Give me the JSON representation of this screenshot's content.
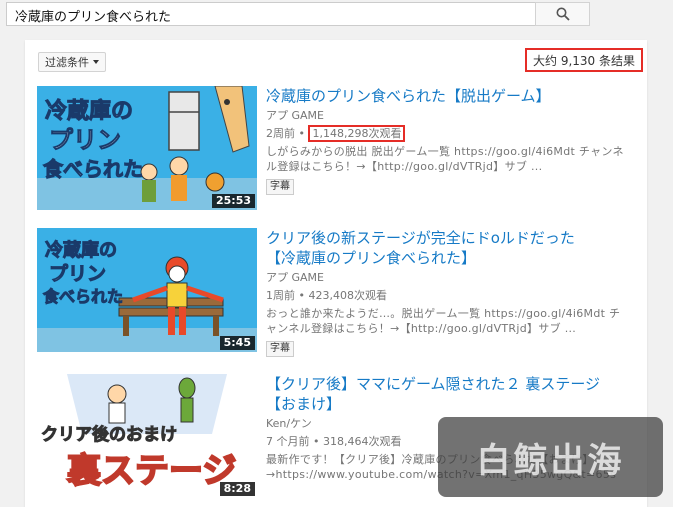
{
  "search": {
    "query": "冷蔵庫のプリン食べられた"
  },
  "toolbar": {
    "filter_label": "过滤条件",
    "result_count": "大约 9,130 条结果"
  },
  "videos": [
    {
      "title": "冷蔵庫のプリン食べられた【脱出ゲーム】",
      "channel": "アプ GAME",
      "age": "2周前 •",
      "views": "1,148,298次观看",
      "desc1": "しがらみからの脱出 脱出ゲーム一覧 https://goo.gl/4i6Mdt チャンネ",
      "desc2": "ル登録はこちら！→【http://goo.gl/dVTRjd】サブ ...",
      "cc": "字幕",
      "duration": "25:53",
      "thumb_text": [
        "冷蔵庫の",
        "プリン",
        "食べられた"
      ]
    },
    {
      "title_line1": "クリア後の新ステージが完全にドoルドだった",
      "title_line2": "【冷蔵庫のプリン食べられた】",
      "channel": "アプ GAME",
      "meta": "1周前 • 423,408次观看",
      "desc1": "おっと誰か来たようだ…。脱出ゲーム一覧 https://goo.gl/4i6Mdt チ",
      "desc2": "ャンネル登録はこちら！→【http://goo.gl/dVTRjd】サブ ...",
      "cc": "字幕",
      "duration": "5:45",
      "thumb_text": [
        "冷蔵庫の",
        "プリン",
        "食べられた"
      ]
    },
    {
      "title_line1": "【クリア後】ママにゲーム隠された２ 裏ステージ",
      "title_line2": "【おまけ】",
      "channel": "Ken/ケン",
      "meta": "7 个月前 • 318,464次观看",
      "desc1": "最新作です！【クリア後】冷蔵庫のプリン食べられた【おまけ】",
      "desc2": "→https://www.youtube.com/watch?v=Xm1_qH35wgQ&t=65s",
      "duration": "8:28",
      "thumb_text": [
        "クリア後のおまけ",
        "裏ステージ"
      ]
    }
  ],
  "watermark": "白鲸出海"
}
